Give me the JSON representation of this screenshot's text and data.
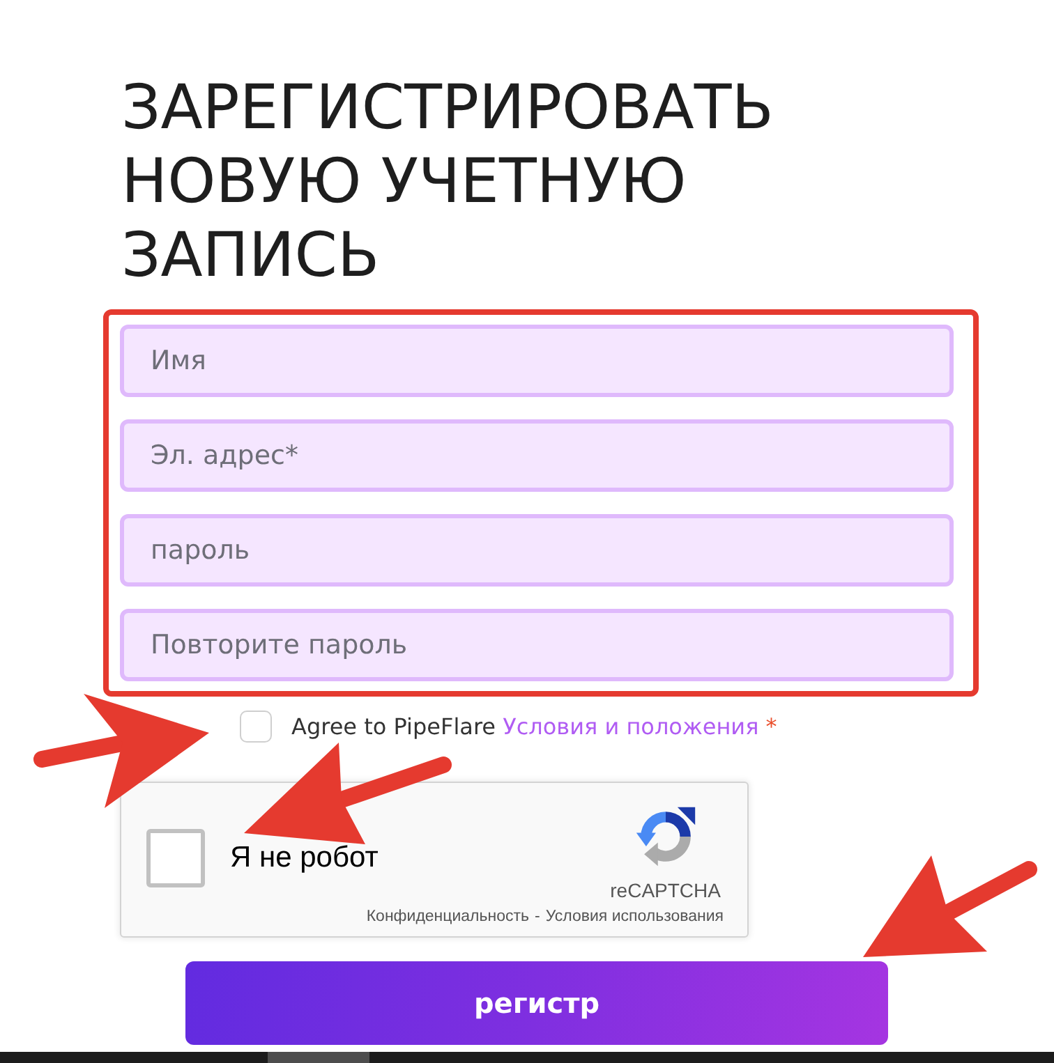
{
  "title": "ЗАРЕГИСТРИРОВАТЬ НОВУЮ УЧЕТНУЮ ЗАПИСЬ",
  "fields": [
    {
      "placeholder": "Имя"
    },
    {
      "placeholder": "Эл. адрес*"
    },
    {
      "placeholder": "пароль"
    },
    {
      "placeholder": "Повторите пароль"
    }
  ],
  "agreement": {
    "checked": false,
    "text": "Agree to PipeFlare",
    "link": "Условия и положения",
    "required_mark": "*"
  },
  "captcha": {
    "checked": false,
    "label": "Я не робот",
    "brand": "reCAPTCHA",
    "links": [
      "Конфиденциальность",
      "Условия использования"
    ],
    "separator": "-"
  },
  "submit_button": {
    "label": "регистр"
  }
}
